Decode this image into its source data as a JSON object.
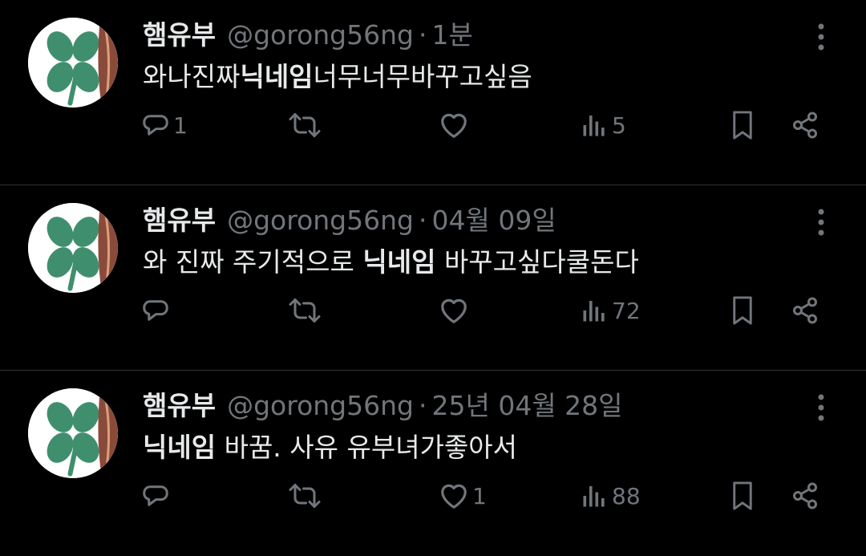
{
  "colors": {
    "background": "#000000",
    "text_primary": "#e7e9ea",
    "text_secondary": "#71767b",
    "divider": "#2f3336"
  },
  "icons": {
    "more": "more-vertical-icon",
    "reply": "reply-icon",
    "repost": "repost-icon",
    "like": "heart-icon",
    "views": "views-icon",
    "bookmark": "bookmark-icon",
    "share": "share-icon"
  },
  "tweets": [
    {
      "author": {
        "display_name": "햄유부",
        "handle": "@gorong56ng"
      },
      "separator": "·",
      "time": "1분",
      "text": {
        "before": "와나진짜",
        "bold": "닉네임",
        "after": "너무너무바꾸고싶음"
      },
      "stats": {
        "replies": "1",
        "reposts": "",
        "likes": "",
        "views": "5"
      }
    },
    {
      "author": {
        "display_name": "햄유부",
        "handle": "@gorong56ng"
      },
      "separator": "·",
      "time": "04월 09일",
      "text": {
        "before": "와 진짜 주기적으로 ",
        "bold": "닉네임",
        "after": " 바꾸고싶다쿨돈다"
      },
      "stats": {
        "replies": "",
        "reposts": "",
        "likes": "",
        "views": "72"
      }
    },
    {
      "author": {
        "display_name": "햄유부",
        "handle": "@gorong56ng"
      },
      "separator": "·",
      "time": "25년 04월 28일",
      "text": {
        "before": "",
        "bold": "닉네임",
        "after": " 바꿈. 사유 유부녀가좋아서"
      },
      "stats": {
        "replies": "",
        "reposts": "",
        "likes": "1",
        "views": "88"
      }
    }
  ]
}
